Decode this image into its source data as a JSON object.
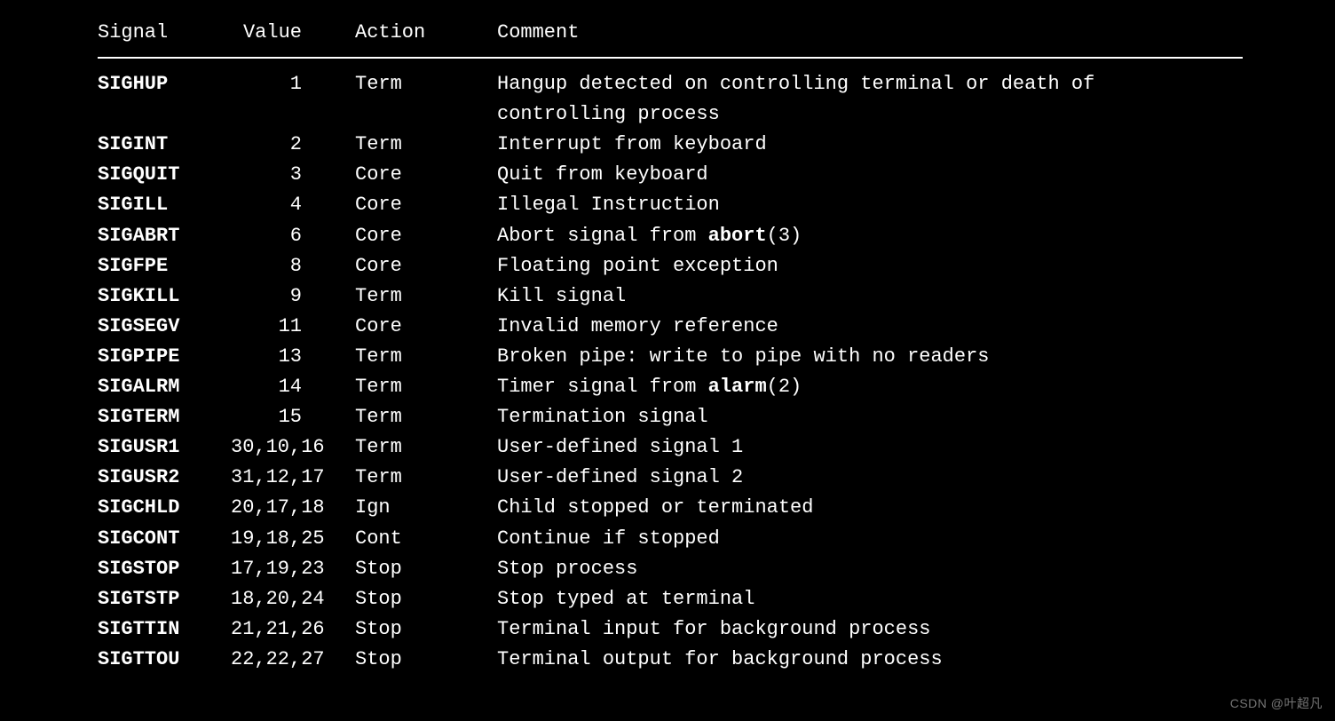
{
  "headers": {
    "signal": "Signal",
    "value": "Value",
    "action": "Action",
    "comment": "Comment"
  },
  "rows": [
    {
      "signal": "SIGHUP",
      "value": "1",
      "action": "Term",
      "comment": "Hangup detected on controlling terminal or death of controlling process"
    },
    {
      "signal": "SIGINT",
      "value": "2",
      "action": "Term",
      "comment": "Interrupt from keyboard"
    },
    {
      "signal": "SIGQUIT",
      "value": "3",
      "action": "Core",
      "comment": "Quit from keyboard"
    },
    {
      "signal": "SIGILL",
      "value": "4",
      "action": "Core",
      "comment": "Illegal Instruction"
    },
    {
      "signal": "SIGABRT",
      "value": "6",
      "action": "Core",
      "comment_pre": "Abort signal from ",
      "ref_bold": "abort",
      "ref_tail": "(3)"
    },
    {
      "signal": "SIGFPE",
      "value": "8",
      "action": "Core",
      "comment": "Floating point exception"
    },
    {
      "signal": "SIGKILL",
      "value": "9",
      "action": "Term",
      "comment": "Kill signal"
    },
    {
      "signal": "SIGSEGV",
      "value": "11",
      "action": "Core",
      "comment": "Invalid memory reference"
    },
    {
      "signal": "SIGPIPE",
      "value": "13",
      "action": "Term",
      "comment": "Broken pipe: write to pipe with no readers"
    },
    {
      "signal": "SIGALRM",
      "value": "14",
      "action": "Term",
      "comment_pre": "Timer signal from ",
      "ref_bold": "alarm",
      "ref_tail": "(2)"
    },
    {
      "signal": "SIGTERM",
      "value": "15",
      "action": "Term",
      "comment": "Termination signal"
    },
    {
      "signal": "SIGUSR1",
      "value": "30,10,16",
      "action": "Term",
      "comment": "User-defined signal 1"
    },
    {
      "signal": "SIGUSR2",
      "value": "31,12,17",
      "action": "Term",
      "comment": "User-defined signal 2"
    },
    {
      "signal": "SIGCHLD",
      "value": "20,17,18",
      "action": "Ign",
      "comment": "Child stopped or terminated"
    },
    {
      "signal": "SIGCONT",
      "value": "19,18,25",
      "action": "Cont",
      "comment": "Continue if stopped"
    },
    {
      "signal": "SIGSTOP",
      "value": "17,19,23",
      "action": "Stop",
      "comment": "Stop process"
    },
    {
      "signal": "SIGTSTP",
      "value": "18,20,24",
      "action": "Stop",
      "comment": "Stop typed at terminal"
    },
    {
      "signal": "SIGTTIN",
      "value": "21,21,26",
      "action": "Stop",
      "comment": "Terminal input for background process"
    },
    {
      "signal": "SIGTTOU",
      "value": "22,22,27",
      "action": "Stop",
      "comment": "Terminal output for background process"
    }
  ],
  "watermark": "CSDN @叶超凡"
}
